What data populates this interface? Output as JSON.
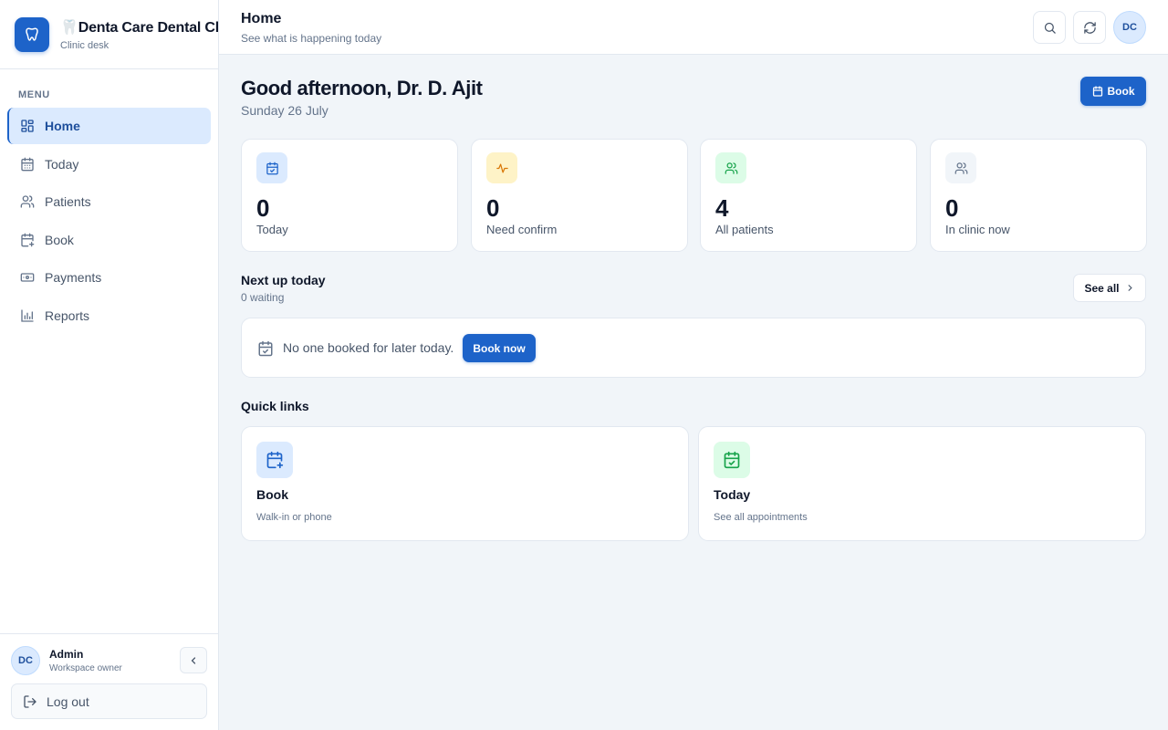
{
  "sidebar": {
    "brand_title": "🦷Denta Care Dental Clinic",
    "brand_sub": "Clinic desk",
    "menu_label": "MENU",
    "items": [
      {
        "label": "Home",
        "icon": "home-grid-icon",
        "active": true
      },
      {
        "label": "Today",
        "icon": "calendar-icon"
      },
      {
        "label": "Patients",
        "icon": "users-icon"
      },
      {
        "label": "Book",
        "icon": "calendar-plus-icon"
      },
      {
        "label": "Payments",
        "icon": "banknote-icon"
      },
      {
        "label": "Reports",
        "icon": "bar-chart-icon"
      }
    ],
    "user": {
      "initials": "DC",
      "name": "Admin",
      "role": "Workspace owner"
    },
    "logout_label": "Log out"
  },
  "header": {
    "title": "Home",
    "subtitle": "See what is happening today",
    "avatar_initials": "DC"
  },
  "main": {
    "greeting": "Good afternoon, Dr. D. Ajit",
    "date": "Sunday 26 July",
    "book_label": "Book",
    "stats": [
      {
        "value": "0",
        "label": "Today",
        "icon": "calendar-check-icon",
        "bg": "#dbeafe",
        "fg": "#1d63c9"
      },
      {
        "value": "0",
        "label": "Need confirm",
        "icon": "activity-icon",
        "bg": "#fef3c7",
        "fg": "#d97706"
      },
      {
        "value": "4",
        "label": "All patients",
        "icon": "users-icon",
        "bg": "#dcfce7",
        "fg": "#16a34a"
      },
      {
        "value": "0",
        "label": "In clinic now",
        "icon": "users-icon",
        "bg": "#f1f5f9",
        "fg": "#64748b"
      }
    ],
    "next_up": {
      "title": "Next up today",
      "sub": "0 waiting",
      "see_all_label": "See all",
      "empty_text": "No one booked for later today.",
      "book_now_label": "Book now"
    },
    "quick_links": {
      "title": "Quick links",
      "items": [
        {
          "title": "Book",
          "sub": "Walk-in or phone",
          "icon": "calendar-plus-icon",
          "bg": "#dbeafe",
          "fg": "#1d63c9"
        },
        {
          "title": "Today",
          "sub": "See all appointments",
          "icon": "calendar-check-icon",
          "bg": "#dcfce7",
          "fg": "#16a34a"
        }
      ]
    }
  },
  "colors": {
    "accent": "#1d63c9",
    "background": "#f1f5f9"
  }
}
